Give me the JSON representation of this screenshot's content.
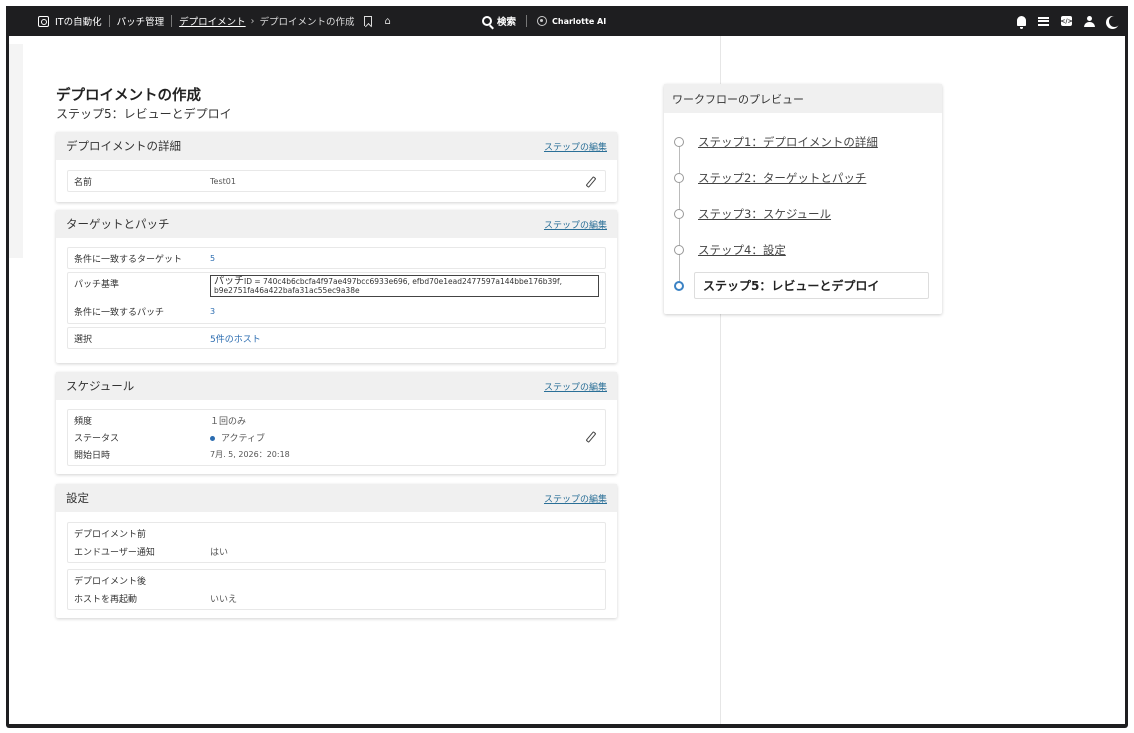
{
  "topbar": {
    "app_name": "ITの自動化",
    "module": "パッチ管理",
    "crumb_link": "デプロイメント",
    "crumb_current": "デプロイメントの作成",
    "search_label": "検索",
    "ai_label": "Charlotte AI"
  },
  "page": {
    "title": "デプロイメントの作成",
    "subtitle": "ステップ5：レビューとデプロイ"
  },
  "edit_label": "ステップの編集",
  "details": {
    "title": "デプロイメントの詳細",
    "name_label": "名前",
    "name_value": "Test01"
  },
  "targets": {
    "title": "ターゲットとパッチ",
    "matching_targets_label": "条件に一致するターゲット",
    "matching_targets_value": "5",
    "patch_criteria_label": "パッチ基準",
    "patch_criteria_prefix": "パッチ",
    "patch_criteria_line1": "ID = 740c4b6cbcfa4f97ae497bcc6933e696, efbd70e1ead2477597a144bbe176b39f,",
    "patch_criteria_line2": "b9e2751fa46a422bafa31ac55ec9a38e",
    "matching_patches_label": "条件に一致するパッチ",
    "matching_patches_value": "3",
    "selection_label": "選択",
    "selection_value": "5件のホスト"
  },
  "schedule": {
    "title": "スケジュール",
    "frequency_label": "頻度",
    "frequency_value": "１回のみ",
    "status_label": "ステータス",
    "status_value": "アクティブ",
    "start_label": "開始日時",
    "start_value": "7月. 5, 2026：20:18"
  },
  "settings": {
    "title": "設定",
    "pre_title": "デプロイメント前",
    "notify_label": "エンドユーザー通知",
    "notify_value": "はい",
    "post_title": "デプロイメント後",
    "restart_label": "ホストを再起動",
    "restart_value": "いいえ"
  },
  "workflow": {
    "title": "ワークフローのプレビュー",
    "steps": [
      "ステップ1：デプロイメントの詳細",
      "ステップ2：ターゲットとパッチ",
      "ステップ3：スケジュール",
      "ステップ4：設定",
      "ステップ5：レビューとデプロイ"
    ],
    "active_step": 5
  },
  "colors": {
    "topbar_bg": "#1e1e20",
    "link": "#2a6f97",
    "accent": "#3b82c4"
  },
  "icons": [
    "menu-icon",
    "app-icon",
    "bookmark-icon",
    "home-icon",
    "search-icon",
    "charlotte-ai-icon",
    "bell-icon",
    "news-icon",
    "code-icon",
    "user-icon",
    "moon-icon",
    "pencil-icon"
  ]
}
